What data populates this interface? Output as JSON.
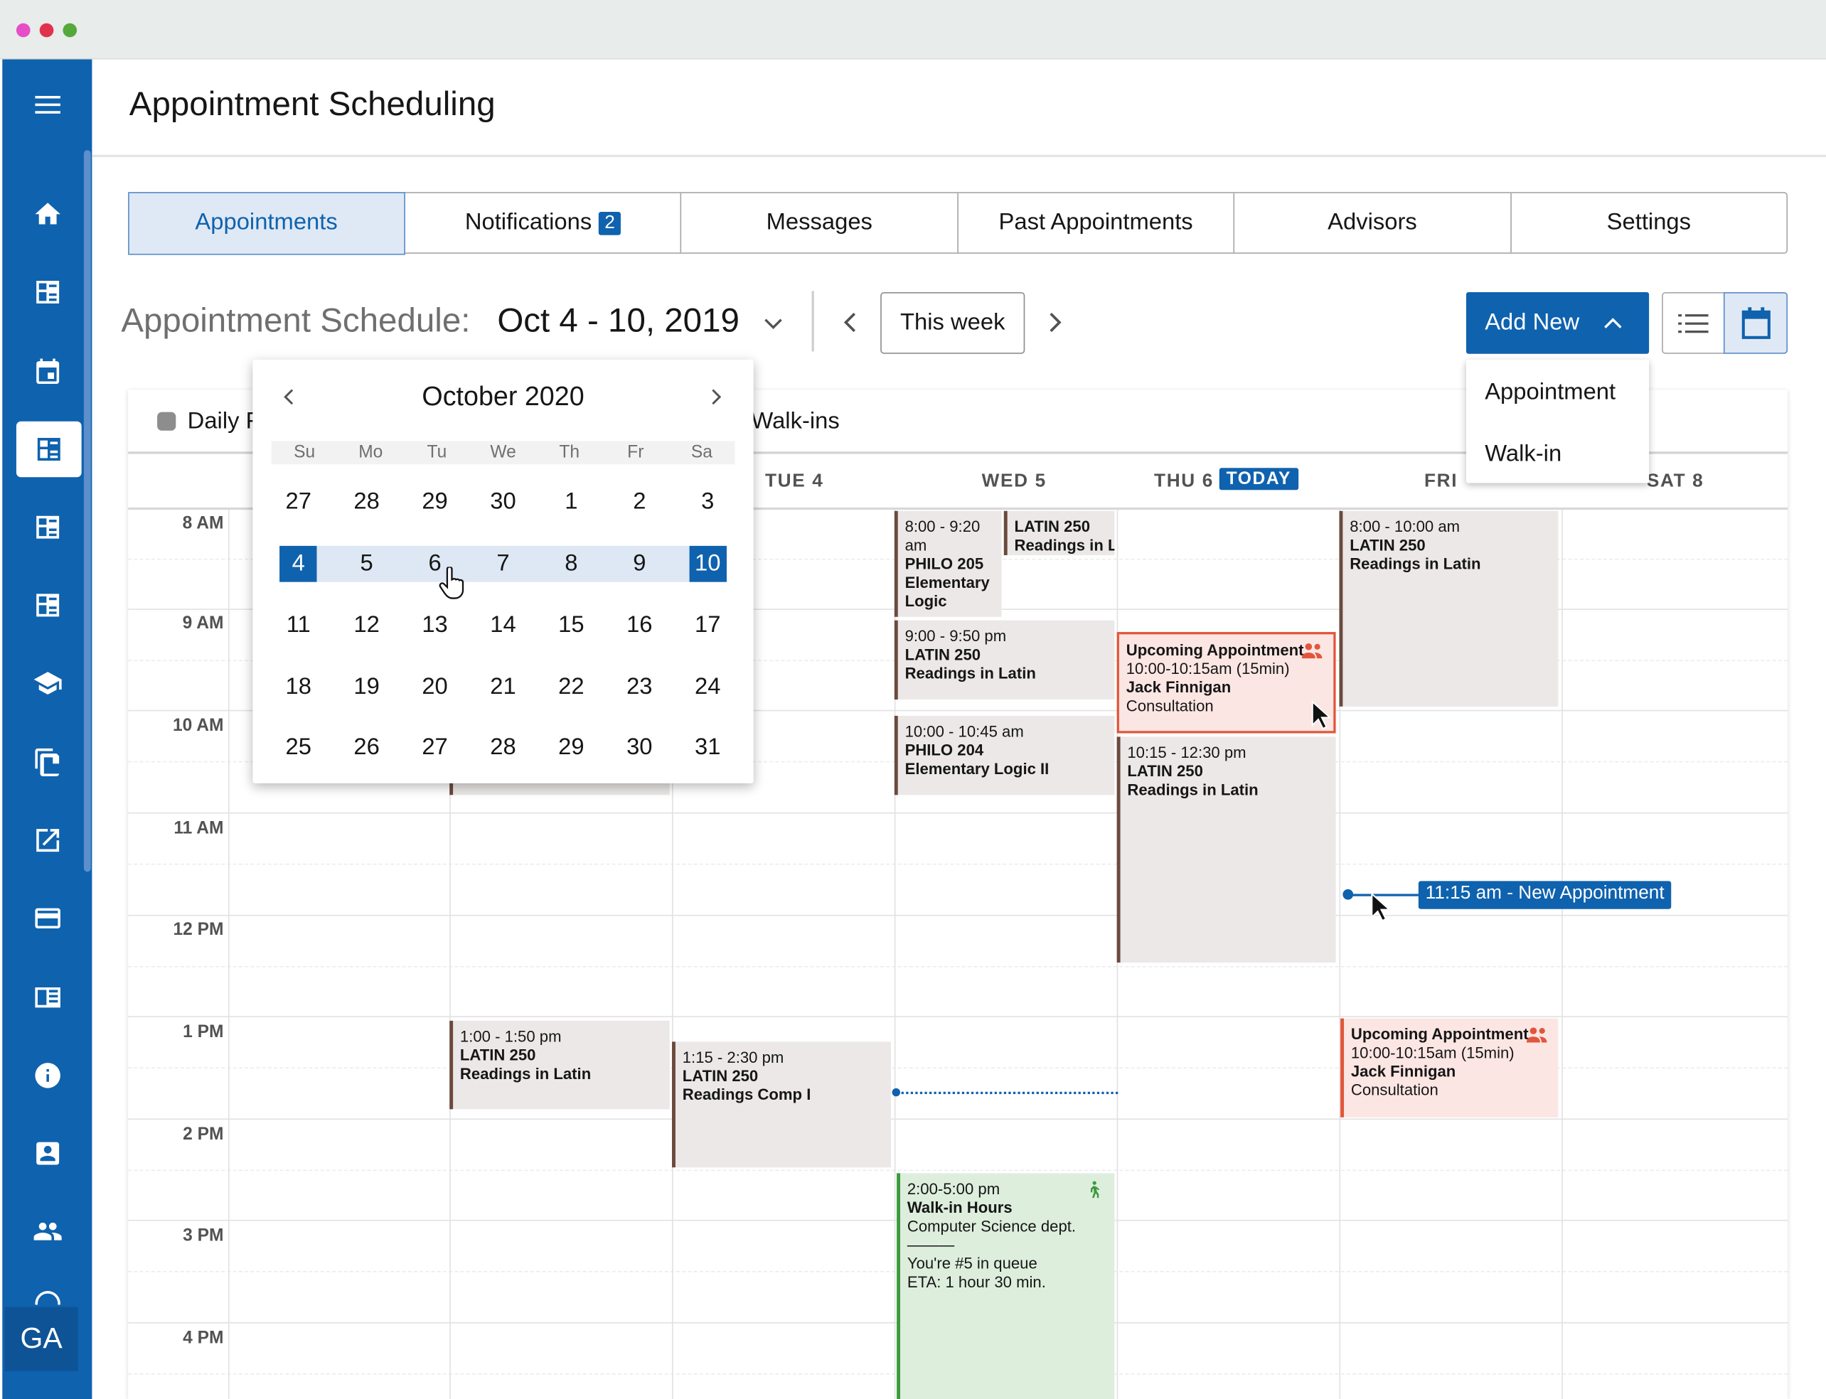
{
  "app": {
    "title": "Appointment Scheduling",
    "avatar_initials": "GA"
  },
  "sidebar": {
    "items": [
      {
        "icon": "menu-icon"
      },
      {
        "icon": "home-icon"
      },
      {
        "icon": "dashboard-icon"
      },
      {
        "icon": "calendar-icon"
      },
      {
        "icon": "dashboard-icon",
        "active": true
      },
      {
        "icon": "dashboard-icon"
      },
      {
        "icon": "dashboard-icon"
      },
      {
        "icon": "graduation-cap-icon"
      },
      {
        "icon": "documents-icon"
      },
      {
        "icon": "external-link-icon"
      },
      {
        "icon": "credit-card-icon"
      },
      {
        "icon": "book-icon"
      },
      {
        "icon": "info-icon"
      },
      {
        "icon": "contact-card-icon"
      },
      {
        "icon": "group-icon"
      }
    ]
  },
  "tabs": [
    {
      "label": "Appointments",
      "active": true
    },
    {
      "label": "Notifications",
      "badge": "2"
    },
    {
      "label": "Messages"
    },
    {
      "label": "Past Appointments"
    },
    {
      "label": "Advisors"
    },
    {
      "label": "Settings"
    }
  ],
  "schedule": {
    "label": "Appointment Schedule:",
    "range": "Oct 4 - 10, 2019",
    "this_week": "This week",
    "add_new": "Add New",
    "add_menu": [
      "Appointment",
      "Walk-in"
    ]
  },
  "legend": {
    "daily": "Daily F",
    "walkins": "Walk-ins"
  },
  "calendar": {
    "days": [
      "TUE 4",
      "WED 5",
      "THU 6",
      "FRI 7",
      "SAT 8"
    ],
    "fri_visible": "FRI",
    "sat_visible": "SAT 8",
    "today_label": "TODAY",
    "hours": [
      "8 AM",
      "9 AM",
      "10 AM",
      "11 AM",
      "12 PM",
      "1 PM",
      "2 PM",
      "3 PM",
      "4 PM"
    ],
    "events": {
      "mon_latin": {
        "time": "1:00 - 1:50 pm",
        "course": "LATIN 250",
        "title": "Readings in Latin"
      },
      "tue_latin": {
        "time": "1:15 - 2:30 pm",
        "course": "LATIN 250",
        "title": "Readings Comp I"
      },
      "wed_philo205": {
        "time": "8:00 - 9:20 am",
        "course": "PHILO 205",
        "title": "Elementary Logic"
      },
      "wed_latin_short": {
        "course": "LATIN 250",
        "title": "Readings in L"
      },
      "wed_latin_9": {
        "time": "9:00 - 9:50 pm",
        "course": "LATIN 250",
        "title": "Readings in Latin"
      },
      "wed_philo204": {
        "time": "10:00 - 10:45 am",
        "course": "PHILO 204",
        "title": "Elementary Logic II"
      },
      "wed_walkin": {
        "time": "2:00-5:00 pm",
        "title": "Walk-in Hours",
        "dept": "Computer Science dept.",
        "rule": "———",
        "queue": "You're #5 in queue",
        "eta": "ETA: 1 hour 30 min."
      },
      "thu_upcoming": {
        "title": "Upcoming Appointment",
        "time": "10:00-10:15am (15min)",
        "person": "Jack Finnigan",
        "type": "Consultation"
      },
      "thu_latin": {
        "time": "10:15 - 12:30 pm",
        "course": "LATIN 250",
        "title": "Readings in Latin"
      },
      "fri_latin": {
        "time": "8:00 - 10:00 am",
        "course": "LATIN 250",
        "title": "Readings in Latin"
      },
      "fri_upcoming": {
        "title": "Upcoming Appointment",
        "time": "10:00-10:15am (15min)",
        "person": "Jack Finnigan",
        "type": "Consultation"
      }
    },
    "new_appointment": "11:15 am - New Appointment"
  },
  "datepicker": {
    "title": "October 2020",
    "weekdays": [
      "Su",
      "Mo",
      "Tu",
      "We",
      "Th",
      "Fr",
      "Sa"
    ],
    "weeks": [
      [
        "27",
        "28",
        "29",
        "30",
        "1",
        "2",
        "3"
      ],
      [
        "4",
        "5",
        "6",
        "7",
        "8",
        "9",
        "10"
      ],
      [
        "11",
        "12",
        "13",
        "14",
        "15",
        "16",
        "17"
      ],
      [
        "18",
        "19",
        "20",
        "21",
        "22",
        "23",
        "24"
      ],
      [
        "25",
        "26",
        "27",
        "28",
        "29",
        "30",
        "31"
      ]
    ],
    "selected_start": "4",
    "selected_end": "10"
  },
  "colors": {
    "brand": "#0f62ae",
    "upcoming": "#e2563b",
    "walkin": "#3c9a3c",
    "event_bg": "#ebe8e7"
  }
}
